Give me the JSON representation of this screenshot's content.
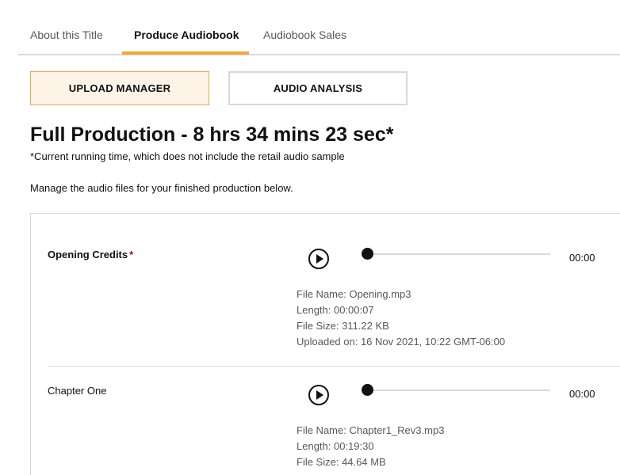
{
  "tabs": [
    {
      "label": "About this Title",
      "active": false
    },
    {
      "label": "Produce Audiobook",
      "active": true
    },
    {
      "label": "Audiobook Sales",
      "active": false
    }
  ],
  "accent_color": "#f0a83a",
  "buttons": {
    "upload_manager": "UPLOAD MANAGER",
    "audio_analysis": "AUDIO ANALYSIS"
  },
  "page": {
    "title": "Full Production - 8 hrs 34 mins 23 sec*",
    "note": "*Current running time, which does not include the retail audio sample",
    "instructions": "Manage the audio files for your finished production below."
  },
  "tracks": [
    {
      "name": "Opening Credits",
      "required_mark": "*",
      "time": "00:00",
      "progress": 0,
      "file_name": "File Name: Opening.mp3",
      "length": "Length: 00:00:07",
      "file_size": "File Size: 311.22 KB",
      "uploaded": "Uploaded on: 16 Nov 2021, 10:22 GMT-06:00"
    },
    {
      "name": "Chapter One",
      "time": "00:00",
      "progress": 0,
      "file_name": "File Name: Chapter1_Rev3.mp3",
      "length": "Length: 00:19:30",
      "file_size": "File Size: 44.64 MB"
    }
  ]
}
